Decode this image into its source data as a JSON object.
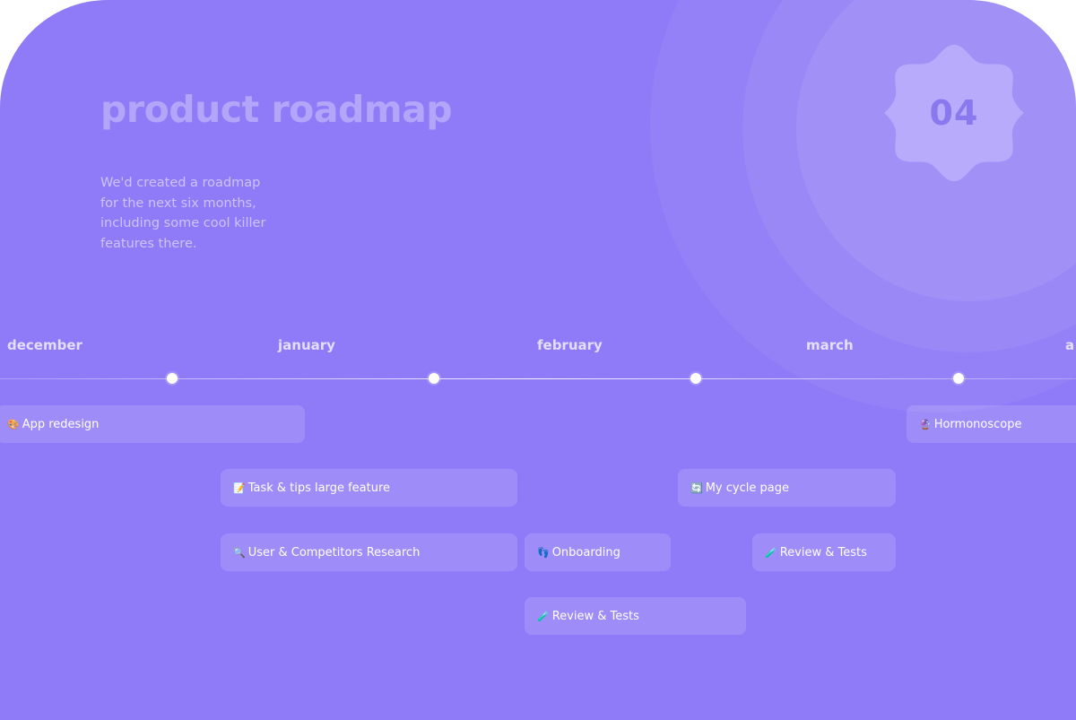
{
  "header": {
    "title": "product roadmap",
    "description_lines": [
      "We'd created a roadmap",
      "for the next six months,",
      "including some cool killer",
      "features there."
    ],
    "badge_number": "04"
  },
  "timeline": {
    "months": [
      "december",
      "january",
      "february",
      "march",
      "a"
    ]
  },
  "tasks": [
    {
      "emoji": "🎨",
      "label": "App redesign"
    },
    {
      "emoji": "🔮",
      "label": "Hormonoscope"
    },
    {
      "emoji": "📝",
      "label": "Task & tips large feature"
    },
    {
      "emoji": "🔄",
      "label": "My cycle page"
    },
    {
      "emoji": "🔍",
      "label": "User & Competitors Research"
    },
    {
      "emoji": "👣",
      "label": "Onboarding"
    },
    {
      "emoji": "🧪",
      "label": "Review & Tests"
    },
    {
      "emoji": "🧪",
      "label": "Review & Tests"
    }
  ],
  "colors": {
    "background": "#8f7bf7",
    "badge_fill": "#b8abfb",
    "badge_text": "#8a78ef"
  }
}
